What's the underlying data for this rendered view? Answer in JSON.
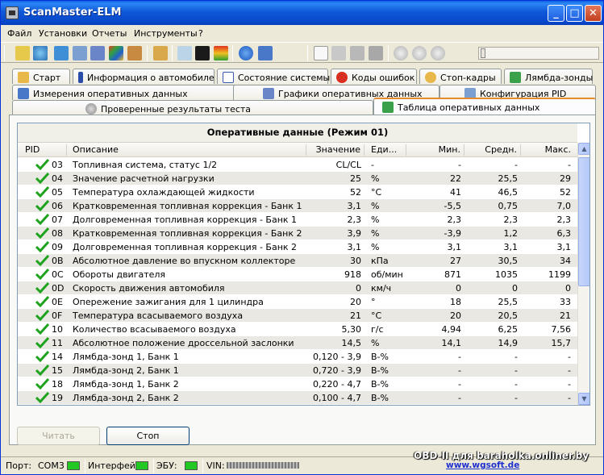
{
  "window": {
    "title": "ScanMaster-ELM"
  },
  "menu": [
    "Файл",
    "Установки",
    "Отчеты",
    "Инструменты",
    "?"
  ],
  "tabs_row1": [
    "Старт",
    "Информация о автомобиле",
    "Состояние системы",
    "Коды ошибок",
    "Стоп-кадры",
    "Лямбда-зонды"
  ],
  "tabs_row2": [
    "Измерения оперативных данных",
    "Графики оперативных данных",
    "Конфигурация PID"
  ],
  "tabs_row3": [
    "Проверенные результаты теста",
    "Таблица оперативных данных"
  ],
  "grid": {
    "title": "Оперативные данные (Режим 01)",
    "headers": {
      "pid": "PID",
      "desc": "Описание",
      "value": "Значение",
      "unit": "Еди...",
      "min": "Мин.",
      "avg": "Средн.",
      "max": "Макс."
    },
    "rows": [
      {
        "pid": "03",
        "desc": "Топливная система, статус 1/2",
        "value": "CL/CL",
        "unit": "-",
        "min": "-",
        "avg": "-",
        "max": "-"
      },
      {
        "pid": "04",
        "desc": "Значение расчетной нагрузки",
        "value": "25",
        "unit": "%",
        "min": "22",
        "avg": "25,5",
        "max": "29"
      },
      {
        "pid": "05",
        "desc": "Температура охлаждающей жидкости",
        "value": "52",
        "unit": "°C",
        "min": "41",
        "avg": "46,5",
        "max": "52"
      },
      {
        "pid": "06",
        "desc": "Кратковременная топливная коррекция - Банк 1",
        "value": "3,1",
        "unit": "%",
        "min": "-5,5",
        "avg": "0,75",
        "max": "7,0"
      },
      {
        "pid": "07",
        "desc": "Долговременная топливная коррекция - Банк 1",
        "value": "2,3",
        "unit": "%",
        "min": "2,3",
        "avg": "2,3",
        "max": "2,3"
      },
      {
        "pid": "08",
        "desc": "Кратковременная топливная коррекция - Банк 2",
        "value": "3,9",
        "unit": "%",
        "min": "-3,9",
        "avg": "1,2",
        "max": "6,3"
      },
      {
        "pid": "09",
        "desc": "Долговременная топливная коррекция - Банк 2",
        "value": "3,1",
        "unit": "%",
        "min": "3,1",
        "avg": "3,1",
        "max": "3,1"
      },
      {
        "pid": "0B",
        "desc": "Абсолютное давление во впускном коллекторе",
        "value": "30",
        "unit": "кПа",
        "min": "27",
        "avg": "30,5",
        "max": "34"
      },
      {
        "pid": "0C",
        "desc": "Обороты двигателя",
        "value": "918",
        "unit": "об/мин",
        "min": "871",
        "avg": "1035",
        "max": "1199"
      },
      {
        "pid": "0D",
        "desc": "Скорость движения автомобиля",
        "value": "0",
        "unit": "км/ч",
        "min": "0",
        "avg": "0",
        "max": "0"
      },
      {
        "pid": "0E",
        "desc": "Опережение зажигания для 1 цилиндра",
        "value": "20",
        "unit": "°",
        "min": "18",
        "avg": "25,5",
        "max": "33"
      },
      {
        "pid": "0F",
        "desc": "Температура  всасываемого воздуха",
        "value": "21",
        "unit": "°C",
        "min": "20",
        "avg": "20,5",
        "max": "21"
      },
      {
        "pid": "10",
        "desc": "Количество всасываемого воздуха",
        "value": "5,30",
        "unit": "г/с",
        "min": "4,94",
        "avg": "6,25",
        "max": "7,56"
      },
      {
        "pid": "11",
        "desc": "Абсолютное положение дроссельной заслонки",
        "value": "14,5",
        "unit": "%",
        "min": "14,1",
        "avg": "14,9",
        "max": "15,7"
      },
      {
        "pid": "14",
        "desc": "Лямбда-зонд 1, Банк 1",
        "value": "0,120 - 3,9",
        "unit": "В-%",
        "min": "-",
        "avg": "-",
        "max": "-"
      },
      {
        "pid": "15",
        "desc": "Лямбда-зонд 2, Банк 1",
        "value": "0,720 - 3,9",
        "unit": "В-%",
        "min": "-",
        "avg": "-",
        "max": "-"
      },
      {
        "pid": "18",
        "desc": "Лямбда-зонд 1, Банк 2",
        "value": "0,220 - 4,7",
        "unit": "В-%",
        "min": "-",
        "avg": "-",
        "max": "-"
      },
      {
        "pid": "19",
        "desc": "Лямбда-зонд 2, Банк 2",
        "value": "0,100 - 4,7",
        "unit": "В-%",
        "min": "-",
        "avg": "-",
        "max": "-"
      }
    ]
  },
  "buttons": {
    "read": "Читать",
    "stop": "Стоп"
  },
  "status": {
    "port_label": "Порт:",
    "port_value": "COM3",
    "interface_label": "Интерфейс:",
    "ecu_label": "ЭБУ:",
    "vin_label": "VIN:"
  },
  "watermark": "OBD-II для baraholka.onliner.by",
  "link": "www.wgsoft.de",
  "colors": {
    "accent": "#0a5fe0",
    "led": "#22c822",
    "check": "#1fa31f"
  }
}
